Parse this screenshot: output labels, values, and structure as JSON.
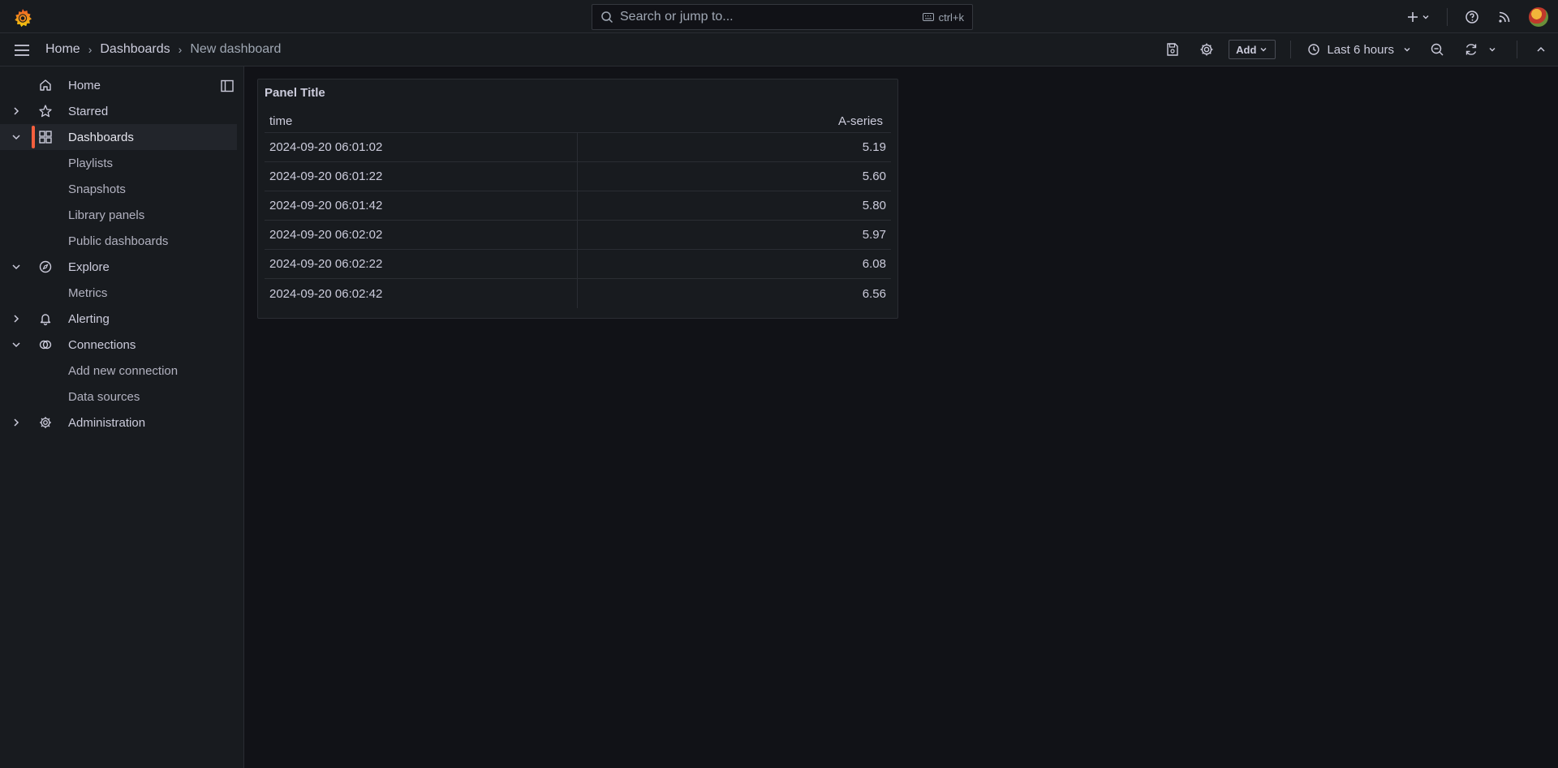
{
  "topbar": {
    "search_placeholder": "Search or jump to...",
    "shortcut": "ctrl+k"
  },
  "breadcrumb": [
    "Home",
    "Dashboards",
    "New dashboard"
  ],
  "toolbar": {
    "add_label": "Add",
    "time_range": "Last 6 hours"
  },
  "sidenav": {
    "items": [
      {
        "label": "Home",
        "icon": "home-icon"
      },
      {
        "label": "Starred",
        "icon": "star-icon"
      },
      {
        "label": "Dashboards",
        "icon": "dashboards-icon"
      },
      {
        "label": "Playlists"
      },
      {
        "label": "Snapshots"
      },
      {
        "label": "Library panels"
      },
      {
        "label": "Public dashboards"
      },
      {
        "label": "Explore",
        "icon": "compass-icon"
      },
      {
        "label": "Metrics"
      },
      {
        "label": "Alerting",
        "icon": "bell-icon"
      },
      {
        "label": "Connections",
        "icon": "connections-icon"
      },
      {
        "label": "Add new connection"
      },
      {
        "label": "Data sources"
      },
      {
        "label": "Administration",
        "icon": "gear-icon"
      }
    ]
  },
  "panel": {
    "title": "Panel Title",
    "columns": [
      "time",
      "A-series"
    ],
    "rows": [
      [
        "2024-09-20 06:01:02",
        "5.19"
      ],
      [
        "2024-09-20 06:01:22",
        "5.60"
      ],
      [
        "2024-09-20 06:01:42",
        "5.80"
      ],
      [
        "2024-09-20 06:02:02",
        "5.97"
      ],
      [
        "2024-09-20 06:02:22",
        "6.08"
      ],
      [
        "2024-09-20 06:02:42",
        "6.56"
      ]
    ]
  },
  "colors": {
    "accent": "#f55f3e",
    "background": "#111217",
    "surface": "#181b1f"
  }
}
